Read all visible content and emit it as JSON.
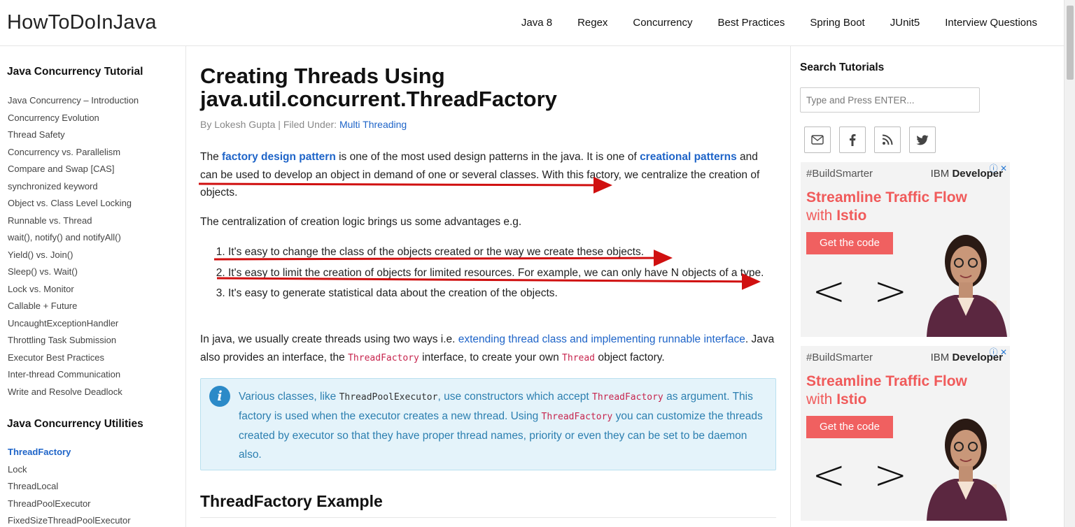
{
  "header": {
    "logo": "HowToDoInJava",
    "nav": [
      "Java 8",
      "Regex",
      "Concurrency",
      "Best Practices",
      "Spring Boot",
      "JUnit5",
      "Interview Questions"
    ]
  },
  "left_sidebar": {
    "section1_title": "Java Concurrency Tutorial",
    "section1_items": [
      "Java Concurrency – Introduction",
      "Concurrency Evolution",
      "Thread Safety",
      "Concurrency vs. Parallelism",
      "Compare and Swap [CAS]",
      "synchronized keyword",
      "Object vs. Class Level Locking",
      "Runnable vs. Thread",
      "wait(), notify() and notifyAll()",
      "Yield() vs. Join()",
      "Sleep() vs. Wait()",
      "Lock vs. Monitor",
      "Callable + Future",
      "UncaughtExceptionHandler",
      "Throttling Task Submission",
      "Executor Best Practices",
      "Inter-thread Communication",
      "Write and Resolve Deadlock"
    ],
    "section2_title": "Java Concurrency Utilities",
    "section2_items": [
      "ThreadFactory",
      "Lock",
      "ThreadLocal",
      "ThreadPoolExecutor",
      "FixedSizeThreadPoolExecutor"
    ]
  },
  "article": {
    "title_line1": "Creating Threads Using",
    "title_line2": "java.util.concurrent.ThreadFactory",
    "byline_prefix": "By Lokesh Gupta | Filed Under: ",
    "byline_category": "Multi Threading",
    "p1": {
      "t1": "The ",
      "link1": "factory design pattern",
      "t2": " is one of the most used design patterns in the java. It is one of ",
      "link2": "creational patterns",
      "t3": " and can be used to develop an object in demand of one or several classes. With this factory, we centralize the creation of objects."
    },
    "p2": "The centralization of creation logic brings us some advantages e.g.",
    "list": [
      "It's easy to change the class of the objects created or the way we create these objects.",
      "It's easy to limit the creation of objects for limited resources. For example, we can only have N objects of a type.",
      "It's easy to generate statistical data about the creation of the objects."
    ],
    "p3": {
      "t1": "In java, we usually create threads using two ways i.e. ",
      "link": "extending thread class and implementing runnable interface",
      "t2": ". Java also provides an interface, the ",
      "code1": "ThreadFactory",
      "t3": " interface, to create your own ",
      "code2": "Thread",
      "t4": " object factory."
    },
    "info": {
      "icon": "i",
      "t1": "Various classes, like ",
      "code1": "ThreadPoolExecutor",
      "t2": ", use constructors which accept ",
      "code2": "ThreadFactory",
      "t3": " as argument. This factory is used when the executor creates a new thread. Using ",
      "code3": "ThreadFactory",
      "t4": " you can customize the threads created by executor so that they have proper thread names, priority or even they can be set to be daemon also."
    },
    "h2": "ThreadFactory Example"
  },
  "right_sidebar": {
    "search_title": "Search Tutorials",
    "search_placeholder": "Type and Press ENTER...",
    "social_icons": [
      "mail-icon",
      "facebook-icon",
      "rss-icon",
      "twitter-icon"
    ],
    "ads": [
      {
        "tag": "#BuildSmarter",
        "brand_prefix": "IBM ",
        "brand_bold": "Developer",
        "headline1": "Streamline Traffic Flow",
        "headline2_prefix": "with ",
        "headline2_bold": "Istio",
        "cta": "Get the code",
        "prev": "<",
        "next": ">",
        "closers": "ⓘ ✕"
      },
      {
        "tag": "#BuildSmarter",
        "brand_prefix": "IBM ",
        "brand_bold": "Developer",
        "headline1": "Streamline Traffic Flow",
        "headline2_prefix": "with ",
        "headline2_bold": "Istio",
        "cta": "Get the code",
        "prev": "<",
        "next": ">",
        "closers": "ⓘ ✕"
      }
    ]
  },
  "colors": {
    "link": "#1e64c8",
    "annotation_red": "#d01010",
    "info_bg": "#e4f3fa",
    "info_text": "#2c7fb0",
    "code_pink": "#c7254e",
    "ad_accent": "#f06060"
  }
}
